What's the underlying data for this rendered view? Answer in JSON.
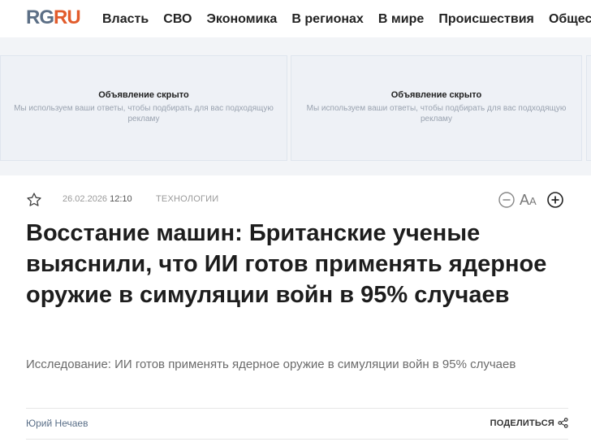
{
  "header": {
    "logo": {
      "rg": "RG",
      "ru": "RU"
    },
    "nav": [
      "Власть",
      "СВО",
      "Экономика",
      "В регионах",
      "В мире",
      "Происшествия",
      "Общество"
    ]
  },
  "ads": [
    {
      "title": "Объявление скрыто",
      "subtitle": "Мы используем ваши ответы, чтобы подбирать для вас подходящую рекламу"
    },
    {
      "title": "Объявление скрыто",
      "subtitle": "Мы используем ваши ответы, чтобы подбирать для вас подходящую рекламу"
    }
  ],
  "article": {
    "date": "26.02.2026",
    "time": "12:10",
    "category": "ТЕХНОЛОГИИ",
    "font_label_big": "A",
    "font_label_small": "A",
    "title": "Восстание машин: Британские ученые выяснили, что ИИ готов применять ядерное оружие в симуляции войн в 95% случаев",
    "lead": "Исследование: ИИ готов применять ядерное оружие в симуляции войн в 95% случаев",
    "author": "Юрий Нечаев",
    "share_label": "ПОДЕЛИТЬСЯ"
  },
  "icons": {
    "star": "star-outline-icon",
    "minus": "circle-minus-icon",
    "plus": "circle-plus-icon",
    "share": "share-icon"
  },
  "colors": {
    "logo_rg": "#5c6f86",
    "logo_ru": "#e25c2c",
    "author": "#5a6f88",
    "ad_bg": "#eef1f6"
  }
}
